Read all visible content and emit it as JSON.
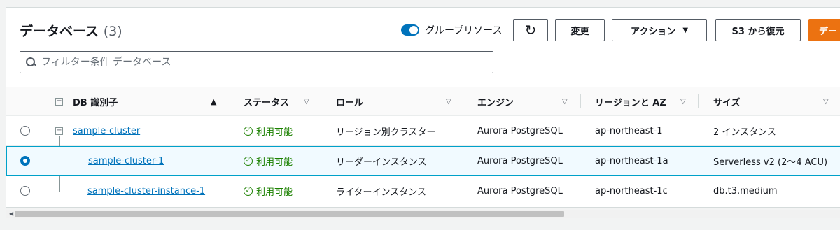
{
  "header": {
    "title": "データベース",
    "count": "(3)",
    "group_toggle_label": "グループリソース",
    "refresh_icon": "refresh-icon",
    "modify_label": "変更",
    "actions_label": "アクション",
    "restore_s3_label": "S3 から復元",
    "create_label": "デー"
  },
  "search": {
    "placeholder": "フィルター条件 データベース",
    "value": ""
  },
  "columns": {
    "db_id": "DB 識別子",
    "status": "ステータス",
    "role": "ロール",
    "engine": "エンジン",
    "region": "リージョンと AZ",
    "size": "サイズ"
  },
  "rows": [
    {
      "id": "sample-cluster",
      "status": "利用可能",
      "role": "リージョン別クラスター",
      "engine": "Aurora PostgreSQL",
      "region": "ap-northeast-1",
      "size": "2 インスタンス",
      "selected": false
    },
    {
      "id": "sample-cluster-1",
      "status": "利用可能",
      "role": "リーダーインスタンス",
      "engine": "Aurora PostgreSQL",
      "region": "ap-northeast-1a",
      "size": "Serverless v2 (2〜4 ACU)",
      "selected": true
    },
    {
      "id": "sample-cluster-instance-1",
      "status": "利用可能",
      "role": "ライターインスタンス",
      "engine": "Aurora PostgreSQL",
      "region": "ap-northeast-1c",
      "size": "db.t3.medium",
      "selected": false
    }
  ],
  "colors": {
    "accent": "#0073bb",
    "primary_button": "#ec7211",
    "status_ok": "#1d8102",
    "selected_row_bg": "#f1faff",
    "selected_row_border": "#00a1c9"
  }
}
